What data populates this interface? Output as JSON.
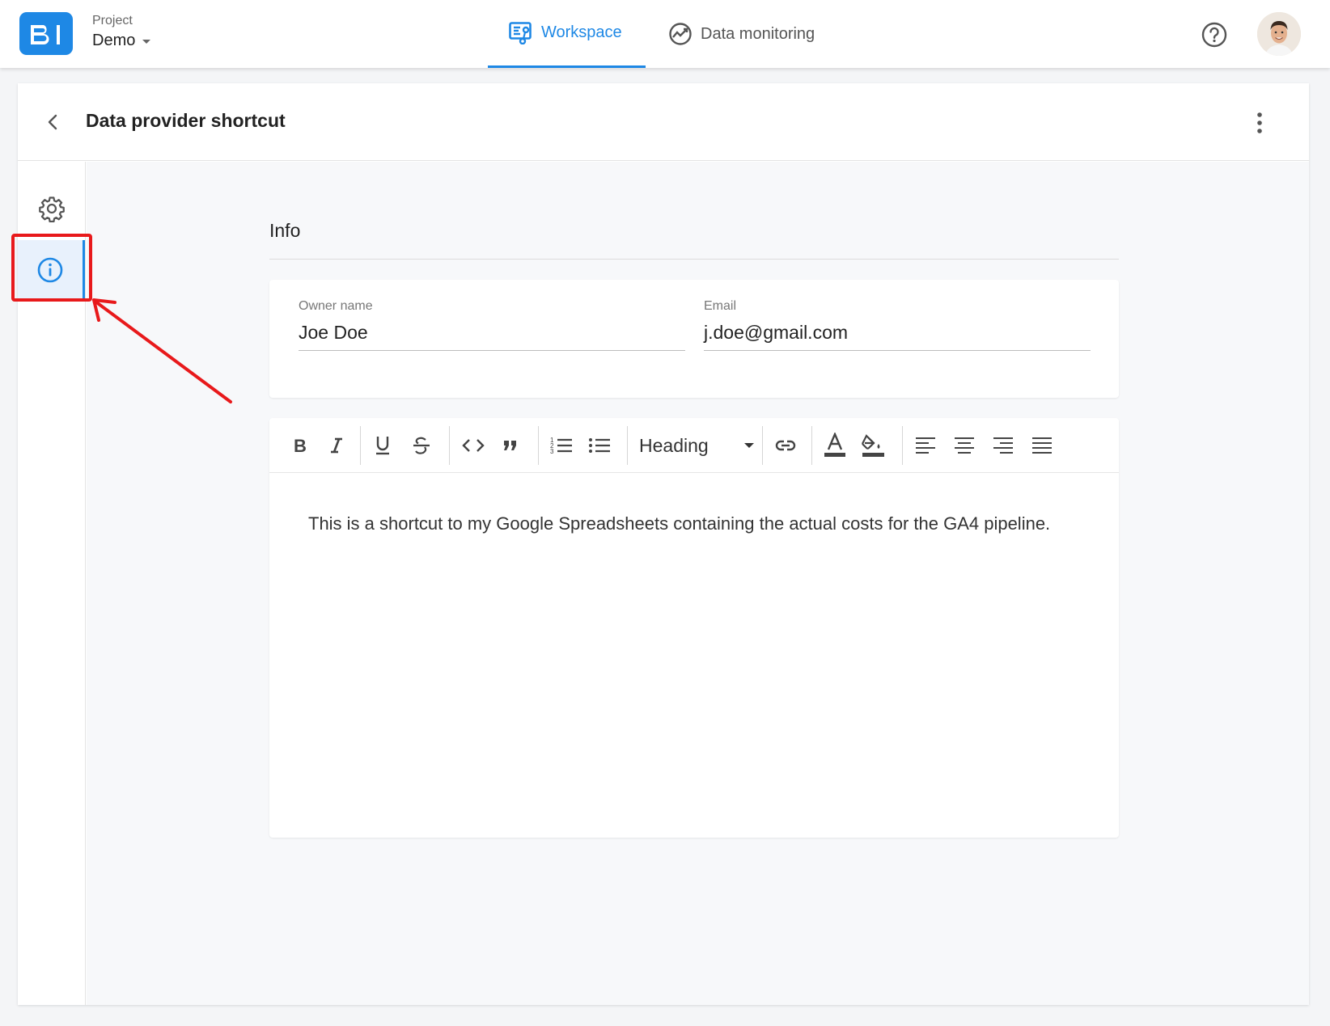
{
  "app": {
    "logo_text": "BI",
    "brand_color": "#1e88e5"
  },
  "header": {
    "project_label": "Project",
    "project_name": "Demo",
    "tabs": [
      {
        "label": "Workspace",
        "icon": "workspace-icon",
        "active": true
      },
      {
        "label": "Data monitoring",
        "icon": "monitoring-icon",
        "active": false
      }
    ],
    "help_icon": "help-circle-icon"
  },
  "page": {
    "title": "Data provider shortcut",
    "side_rail": [
      {
        "icon": "gear-icon",
        "active": false
      },
      {
        "icon": "info-icon",
        "active": true
      }
    ]
  },
  "info": {
    "section_title": "Info",
    "owner_label": "Owner name",
    "owner_value": "Joe Doe",
    "email_label": "Email",
    "email_value": "j.doe@gmail.com"
  },
  "editor": {
    "heading_select": "Heading",
    "toolbar": [
      "bold",
      "italic",
      "underline",
      "strikethrough",
      "code",
      "quote",
      "ordered-list",
      "bulleted-list",
      "heading",
      "link",
      "text-color",
      "fill-color",
      "align-left",
      "align-center",
      "align-right",
      "align-justify"
    ],
    "body_text": "This is a shortcut to my Google Spreadsheets containing the actual costs for the GA4 pipeline."
  },
  "annotation": {
    "color": "#e8191b"
  }
}
